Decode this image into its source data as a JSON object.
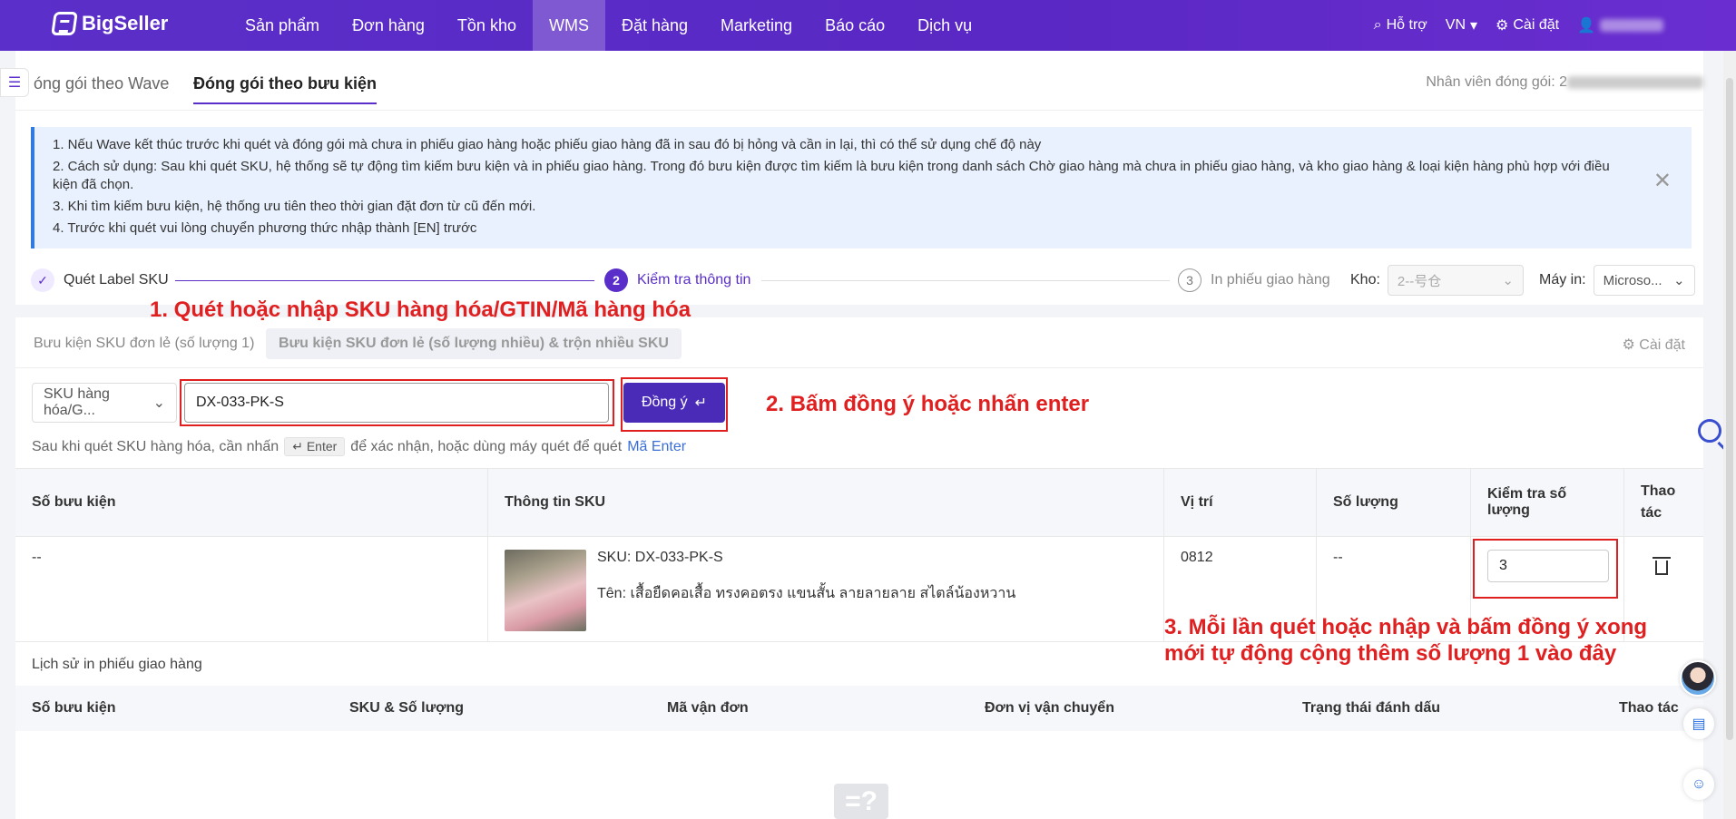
{
  "nav": {
    "logo": "BigSeller",
    "items": [
      "Sản phẩm",
      "Đơn hàng",
      "Tồn kho",
      "WMS",
      "Đặt hàng",
      "Marketing",
      "Báo cáo",
      "Dịch vụ"
    ],
    "support": "Hỗ trợ",
    "lang": "VN",
    "settings": "Cài đặt"
  },
  "tabs": {
    "wave": "óng gói theo Wave",
    "parcel": "Đóng gói theo bưu kiện",
    "packer_label": "Nhân viên đóng gói: 2"
  },
  "notice": {
    "lines": [
      "1. Nếu Wave kết thúc trước khi quét và đóng gói mà chưa in phiếu giao hàng hoặc phiếu giao hàng đã in sau đó bị hỏng và cần in lại, thì có thể sử dụng chế độ này",
      "2. Cách sử dụng: Sau khi quét SKU, hệ thống sẽ tự động tìm kiếm bưu kiện và in phiếu giao hàng. Trong đó bưu kiện được tìm kiếm là bưu kiện trong danh sách Chờ giao hàng mà chưa in phiếu giao hàng, và kho giao hàng & loại kiện hàng phù hợp với điều kiện đã chọn.",
      "3. Khi tìm kiếm bưu kiện, hệ thống ưu tiên theo thời gian đặt đơn từ cũ đến mới.",
      "4. Trước khi quét vui lòng chuyển phương thức nhập thành [EN] trước"
    ]
  },
  "stepper": {
    "step1": "Quét Label SKU",
    "step2_num": "2",
    "step2": "Kiểm tra thông tin",
    "step3_num": "3",
    "step3": "In phiếu giao hàng",
    "kho_label": "Kho:",
    "kho_value": "2--号仓",
    "printer_label": "Máy in:",
    "printer_value": "Microso..."
  },
  "annotations": {
    "a1": "1. Quét hoặc nhập SKU hàng hóa/GTIN/Mã hàng hóa",
    "a2": "2. Bấm đồng ý hoặc nhấn enter",
    "a3_line1": "3. Mỗi lần quét hoặc nhập và bấm đồng ý xong",
    "a3_line2": "mới tự động cộng thêm số lượng 1 vào đây"
  },
  "subtabs": {
    "single": "Bưu kiện SKU đơn lẻ (số lượng 1)",
    "multi": "Bưu kiện SKU đơn lẻ (số lượng nhiều) & trộn nhiều SKU",
    "settings": "Cài đặt"
  },
  "scan": {
    "select_value": "SKU hàng hóa/G...",
    "input_value": "DX-033-PK-S",
    "agree_label": "Đồng ý",
    "hint_before": "Sau khi quét SKU hàng hóa, cần nhấn",
    "hint_key": "Enter",
    "hint_after": "để xác nhận, hoặc dùng máy quét để quét",
    "hint_link": "Mã Enter"
  },
  "table": {
    "headers": [
      "Số bưu kiện",
      "Thông tin SKU",
      "Vị trí",
      "Số lượng",
      "Kiểm tra số lượng",
      "Thao tác"
    ],
    "row": {
      "parcel_no": "--",
      "sku": "SKU: DX-033-PK-S",
      "name": "Tên: เสื้อยืดคอเสื้อ ทรงคอตรง แขนสั้น ลายลายลาย สไตล์น้องหวาน",
      "location": "0812",
      "quantity": "--",
      "check_qty": "3"
    }
  },
  "history": {
    "title": "Lịch sử in phiếu giao hàng",
    "headers": [
      "Số bưu kiện",
      "SKU & Số lượng",
      "Mã vận đơn",
      "Đơn vị vận chuyển",
      "Trạng thái đánh dấu",
      "Thao tác"
    ]
  },
  "colors": {
    "nav_bg": "#5b2fc9",
    "accent": "#5a2fc9",
    "annotation_red": "#e02020",
    "notice_bg": "#e8f1fd"
  }
}
